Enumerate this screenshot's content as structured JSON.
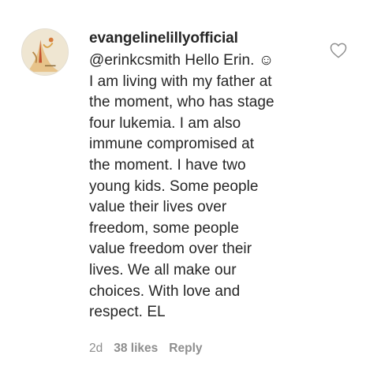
{
  "comment": {
    "username": "evangelinelillyofficial",
    "text": "@erinkcsmith Hello Erin. ☺\nI am living with my father at\nthe moment, who has stage\nfour lukemia. I am also\nimmune compromised at\nthe moment. I have two\nyoung kids. Some people\nvalue their lives over\nfreedom, some people\nvalue freedom over their\nlives. We all make our\nchoices. With love and\nrespect. EL",
    "time": "2d",
    "likes": "38 likes",
    "reply_label": "Reply",
    "like_icon": "heart-outline-icon",
    "avatar_icon": "profile-avatar"
  },
  "colors": {
    "text": "#262626",
    "meta": "#8e8e8e",
    "icon": "#8e8e8e",
    "background": "#ffffff"
  }
}
